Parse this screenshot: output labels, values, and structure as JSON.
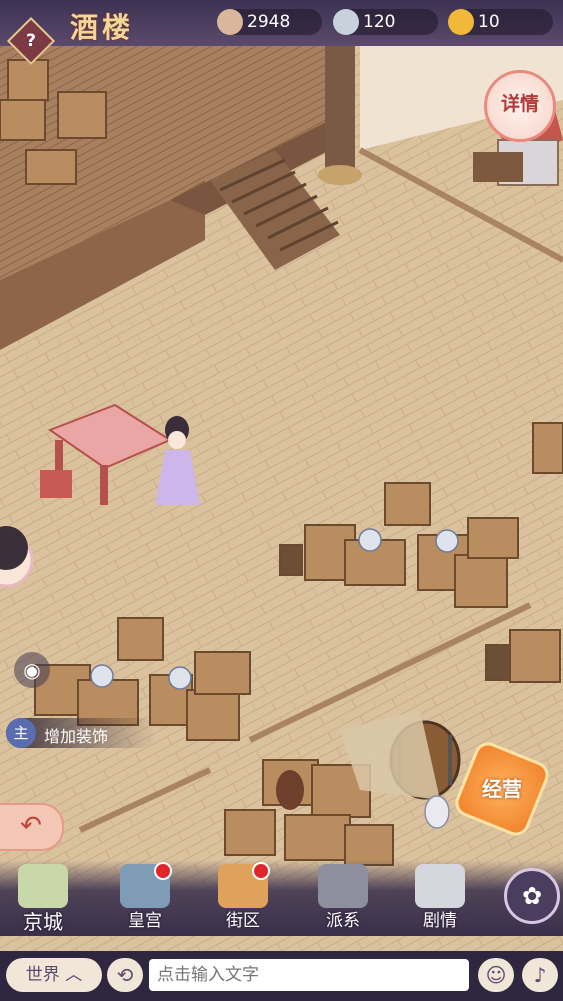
{
  "header": {
    "title": "酒楼",
    "help_label": "?"
  },
  "resources": [
    {
      "name": "prestige",
      "value": "2948",
      "color": "#d9b79a"
    },
    {
      "name": "silver",
      "value": "120",
      "color": "#c9d2dc"
    },
    {
      "name": "gold",
      "value": "10",
      "color": "#f0b93a"
    }
  ],
  "detail_button": "详情",
  "left_panel": {
    "owner_tag": "主",
    "add_decoration": "增加装饰"
  },
  "manage_button": "经营",
  "nav": [
    {
      "label": "京城",
      "badge": false
    },
    {
      "label": "皇宫",
      "badge": true
    },
    {
      "label": "街区",
      "badge": true
    },
    {
      "label": "派系",
      "badge": false
    },
    {
      "label": "剧情",
      "badge": false
    }
  ],
  "chat": {
    "channel": "世界",
    "placeholder": "点击输入文字"
  },
  "colors": {
    "floor": "#d9bf98",
    "wall": "#9a7559",
    "accent_red": "#e0262a",
    "bar": "#3a2f4c"
  }
}
